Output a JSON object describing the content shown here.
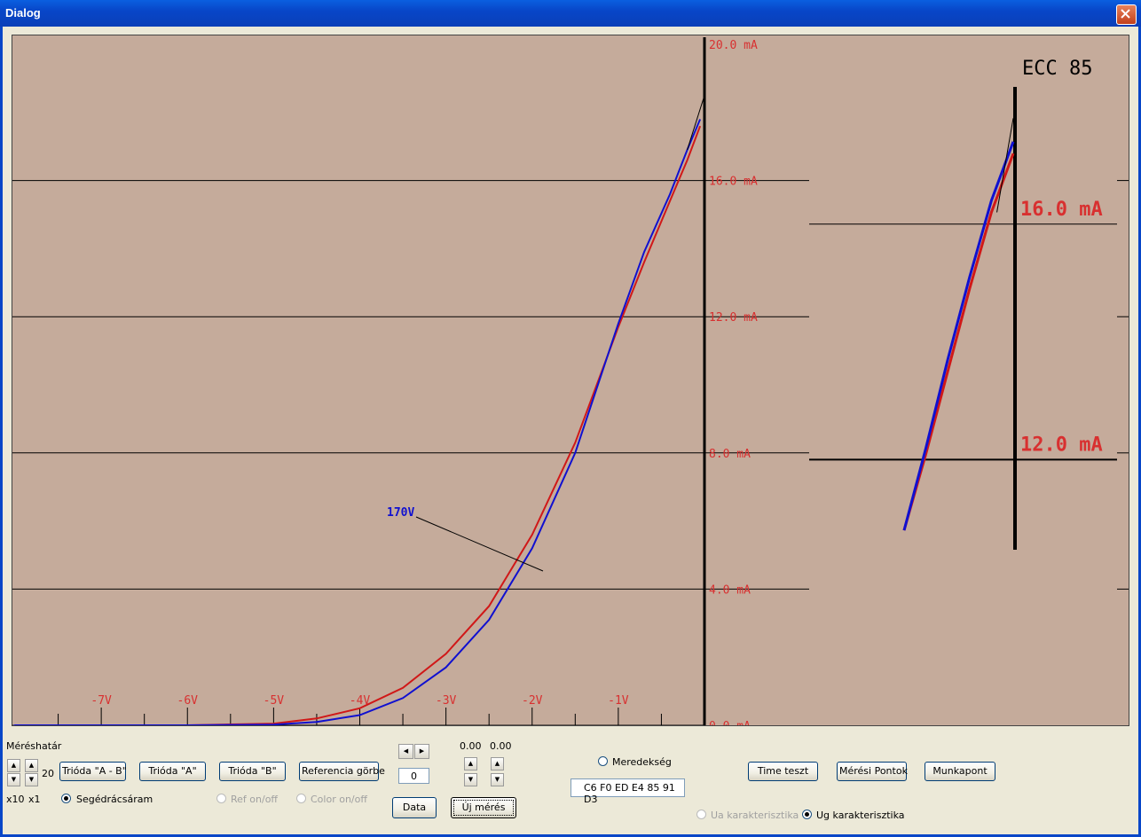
{
  "window": {
    "title": "Dialog"
  },
  "colors": {
    "plot_bg": "#c5ab9b",
    "red": "#d01818",
    "blue": "#1010d0",
    "label_red": "#d83030"
  },
  "chart_data": [
    {
      "type": "line",
      "title": "",
      "xlabel": "",
      "ylabel": "",
      "x_tick_labels": [
        "-7V",
        "-6V",
        "-5V",
        "-4V",
        "-3V",
        "-2V",
        "-1V"
      ],
      "y_tick_labels": [
        "20.0 mA",
        "16.0 mA",
        "12.0 mA",
        "8.0 mA",
        "4.0 mA",
        "0.0 mA"
      ],
      "xlim": [
        -8,
        0
      ],
      "ylim": [
        0,
        20
      ],
      "grid": true,
      "annotation": "170V",
      "series": [
        {
          "color": "#d01818",
          "x": [
            -8.0,
            -6.0,
            -5.0,
            -4.5,
            -4.0,
            -3.5,
            -3.0,
            -2.5,
            -2.0,
            -1.5,
            -1.0,
            -0.7,
            -0.4,
            -0.2,
            -0.05
          ],
          "y": [
            0,
            0,
            0.05,
            0.2,
            0.5,
            1.1,
            2.1,
            3.5,
            5.6,
            8.3,
            11.7,
            13.6,
            15.4,
            16.6,
            17.6
          ]
        },
        {
          "color": "#1010d0",
          "x": [
            -8.0,
            -6.0,
            -5.0,
            -4.5,
            -4.0,
            -3.5,
            -3.0,
            -2.5,
            -2.0,
            -1.5,
            -1.0,
            -0.7,
            -0.4,
            -0.2,
            -0.05
          ],
          "y": [
            0,
            0,
            0.02,
            0.1,
            0.3,
            0.8,
            1.7,
            3.1,
            5.2,
            8.0,
            11.8,
            13.9,
            15.6,
            16.9,
            17.8
          ]
        }
      ]
    },
    {
      "type": "line",
      "title": "ECC 85",
      "y_tick_labels": [
        "16.0 mA",
        "12.0 mA"
      ],
      "ylim": [
        10.5,
        18.0
      ],
      "grid": true,
      "series": [
        {
          "color": "#d01818",
          "x": [
            0,
            0.2,
            0.4,
            0.6,
            0.8,
            1.0
          ],
          "y": [
            10.8,
            12.1,
            13.5,
            14.9,
            16.2,
            17.2
          ]
        },
        {
          "color": "#1010d0",
          "x": [
            0,
            0.2,
            0.4,
            0.6,
            0.8,
            1.0
          ],
          "y": [
            10.8,
            12.2,
            13.7,
            15.1,
            16.4,
            17.4
          ]
        }
      ]
    }
  ],
  "controls": {
    "range_label": "Méréshatár",
    "range_value": "20",
    "x10": "x10",
    "x1": "x1",
    "btn_trioda_ab": "Trióda \"A - B\"",
    "btn_trioda_a": "Trióda  \"A\"",
    "btn_trioda_b": "Trióda  \"B\"",
    "btn_ref": "Referencia görbe",
    "chk_segedracs": "Segédrácsáram",
    "ref_onoff": "Ref on/off",
    "color_onoff": "Color on/off",
    "index_value": "0",
    "val1": "0.00",
    "val2": "0.00",
    "btn_data": "Data",
    "btn_uj": "Új mérés",
    "radio_meredekseg": "Meredekség",
    "hex_value": "C6  F0 ED E4 85 91 D3",
    "btn_time": "Time teszt",
    "btn_meresi": "Mérési Pontok",
    "btn_munkapont": "Munkapont",
    "radio_ua": "Ua karakterisztika",
    "radio_ug": "Ug karakterisztika"
  }
}
